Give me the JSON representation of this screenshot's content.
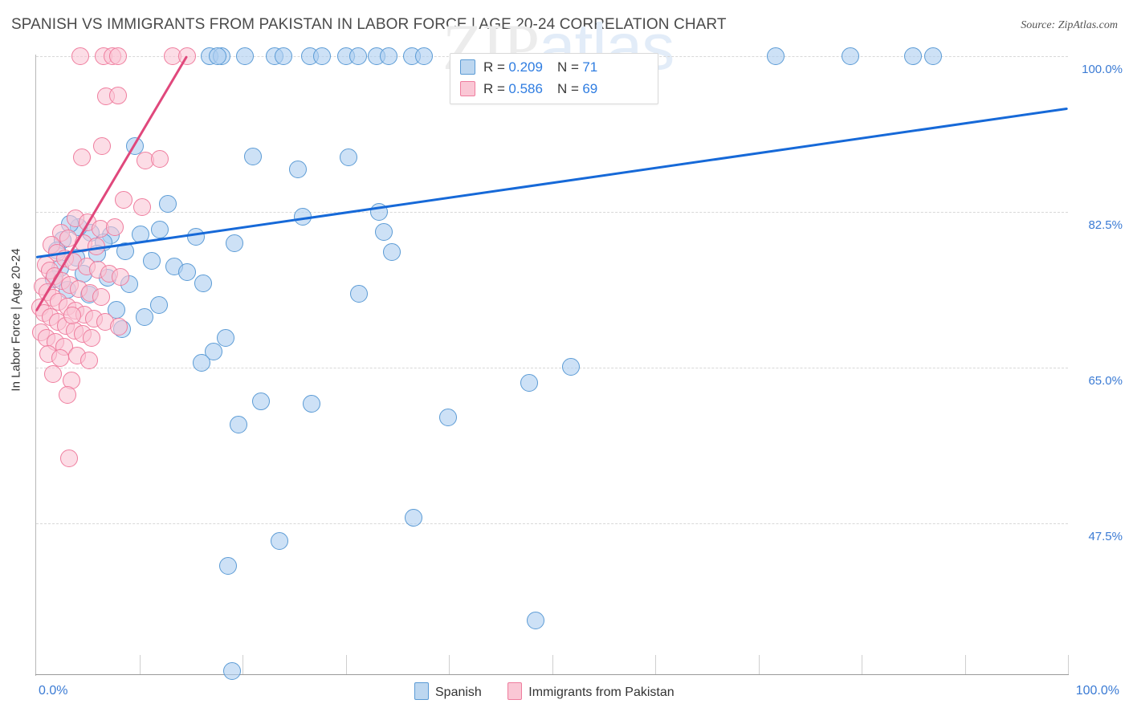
{
  "header": {
    "title": "SPANISH VS IMMIGRANTS FROM PAKISTAN IN LABOR FORCE | AGE 20-24 CORRELATION CHART",
    "source": "Source: ZipAtlas.com"
  },
  "watermark": {
    "part1": "ZIP",
    "part2": "atlas"
  },
  "stats_legend": {
    "rows": [
      {
        "color": "#bdd7f0",
        "r_label": "R =",
        "r_value": "0.209",
        "n_label": "N =",
        "n_value": "71"
      },
      {
        "color": "#fac7d5",
        "r_label": "R =",
        "r_value": "0.586",
        "n_label": "N =",
        "n_value": "69"
      }
    ]
  },
  "bottom_legend": {
    "items": [
      {
        "label": "Spanish",
        "color": "#bdd7f0"
      },
      {
        "label": "Immigrants from Pakistan",
        "color": "#fac7d5"
      }
    ]
  },
  "chart_data": {
    "type": "scatter",
    "title": "SPANISH VS IMMIGRANTS FROM PAKISTAN IN LABOR FORCE | AGE 20-24 CORRELATION CHART",
    "xlabel": "",
    "ylabel": "In Labor Force | Age 20-24",
    "xlim": [
      0,
      100
    ],
    "ylim": [
      30.6,
      100.0
    ],
    "grid": true,
    "legend_position": "bottom-center",
    "x_tick_labels": [
      "0.0%",
      "100.0%"
    ],
    "y_tick_labels": [
      "100.0%",
      "82.5%",
      "65.0%",
      "47.5%"
    ],
    "y_ticks": [
      100.0,
      82.5,
      65.0,
      47.5
    ],
    "series": [
      {
        "name": "Spanish",
        "color": "#bdd7f0",
        "edge_color": "#5b9bd5",
        "r": 0.209,
        "n": 71,
        "trendline": {
          "x0": 0.0,
          "y0": 77.4,
          "x1": 100.0,
          "y1": 94.1
        },
        "points": [
          [
            16.8,
            100.0
          ],
          [
            18.0,
            100.0
          ],
          [
            17.6,
            100.0
          ],
          [
            20.2,
            100.0
          ],
          [
            23.1,
            100.0
          ],
          [
            24.0,
            100.0
          ],
          [
            26.5,
            100.0
          ],
          [
            27.7,
            100.0
          ],
          [
            30.0,
            100.0
          ],
          [
            31.2,
            100.0
          ],
          [
            33.0,
            100.0
          ],
          [
            34.2,
            100.0
          ],
          [
            36.4,
            100.0
          ],
          [
            37.6,
            100.0
          ],
          [
            71.7,
            100.0
          ],
          [
            78.9,
            100.0
          ],
          [
            85.0,
            100.0
          ],
          [
            86.9,
            100.0
          ],
          [
            9.6,
            89.9
          ],
          [
            21.0,
            88.7
          ],
          [
            25.4,
            87.3
          ],
          [
            30.3,
            88.6
          ],
          [
            12.8,
            83.4
          ],
          [
            25.8,
            82.0
          ],
          [
            33.2,
            82.5
          ],
          [
            12.0,
            80.5
          ],
          [
            10.1,
            80.0
          ],
          [
            7.2,
            79.9
          ],
          [
            5.3,
            80.2
          ],
          [
            4.1,
            80.8
          ],
          [
            6.5,
            79.1
          ],
          [
            15.5,
            79.7
          ],
          [
            19.2,
            79.0
          ],
          [
            8.6,
            78.1
          ],
          [
            3.3,
            81.2
          ],
          [
            2.6,
            79.4
          ],
          [
            2.0,
            78.2
          ],
          [
            3.9,
            77.4
          ],
          [
            5.9,
            77.8
          ],
          [
            11.2,
            77.0
          ],
          [
            13.4,
            76.4
          ],
          [
            14.6,
            75.8
          ],
          [
            33.7,
            80.3
          ],
          [
            34.5,
            78.0
          ],
          [
            2.3,
            76.2
          ],
          [
            4.6,
            75.6
          ],
          [
            6.9,
            75.1
          ],
          [
            9.0,
            74.4
          ],
          [
            1.7,
            74.9
          ],
          [
            3.0,
            73.8
          ],
          [
            5.1,
            73.2
          ],
          [
            16.2,
            74.5
          ],
          [
            11.9,
            72.1
          ],
          [
            7.8,
            71.5
          ],
          [
            10.5,
            70.7
          ],
          [
            31.3,
            73.3
          ],
          [
            8.3,
            69.4
          ],
          [
            18.4,
            68.4
          ],
          [
            17.2,
            66.8
          ],
          [
            16.0,
            65.6
          ],
          [
            51.8,
            65.1
          ],
          [
            47.8,
            63.3
          ],
          [
            21.8,
            61.2
          ],
          [
            26.7,
            61.0
          ],
          [
            19.6,
            58.6
          ],
          [
            39.9,
            59.4
          ],
          [
            36.6,
            48.2
          ],
          [
            23.6,
            45.6
          ],
          [
            18.6,
            42.8
          ],
          [
            48.4,
            36.6
          ],
          [
            19.0,
            31.0
          ]
        ]
      },
      {
        "name": "Immigrants from Pakistan",
        "color": "#fac7d5",
        "edge_color": "#ef7d9e",
        "r": 0.586,
        "n": 69,
        "trendline": {
          "x0": 0.0,
          "y0": 71.4,
          "x1": 14.6,
          "y1": 100.0
        },
        "points": [
          [
            4.3,
            100.0
          ],
          [
            6.5,
            100.0
          ],
          [
            7.4,
            100.0
          ],
          [
            7.9,
            100.0
          ],
          [
            13.2,
            100.0
          ],
          [
            14.6,
            100.0
          ],
          [
            6.8,
            95.5
          ],
          [
            7.9,
            95.6
          ],
          [
            6.4,
            89.9
          ],
          [
            4.4,
            88.6
          ],
          [
            10.6,
            88.3
          ],
          [
            12.0,
            88.5
          ],
          [
            8.5,
            83.9
          ],
          [
            10.3,
            83.1
          ],
          [
            3.8,
            81.8
          ],
          [
            5.0,
            81.3
          ],
          [
            6.2,
            80.6
          ],
          [
            7.6,
            80.8
          ],
          [
            2.4,
            80.2
          ],
          [
            3.1,
            79.5
          ],
          [
            4.6,
            79.0
          ],
          [
            5.8,
            78.6
          ],
          [
            1.5,
            78.8
          ],
          [
            2.0,
            77.9
          ],
          [
            2.8,
            77.3
          ],
          [
            3.6,
            76.9
          ],
          [
            4.9,
            76.4
          ],
          [
            6.0,
            76.0
          ],
          [
            7.1,
            75.6
          ],
          [
            8.2,
            75.2
          ],
          [
            0.9,
            76.6
          ],
          [
            1.3,
            75.9
          ],
          [
            1.8,
            75.3
          ],
          [
            2.5,
            74.8
          ],
          [
            3.3,
            74.3
          ],
          [
            4.1,
            73.9
          ],
          [
            5.2,
            73.4
          ],
          [
            6.3,
            73.0
          ],
          [
            0.6,
            74.1
          ],
          [
            1.1,
            73.5
          ],
          [
            1.6,
            72.9
          ],
          [
            2.2,
            72.4
          ],
          [
            3.0,
            71.9
          ],
          [
            3.8,
            71.4
          ],
          [
            4.7,
            71.0
          ],
          [
            5.6,
            70.5
          ],
          [
            0.4,
            71.8
          ],
          [
            0.8,
            71.2
          ],
          [
            1.4,
            70.7
          ],
          [
            2.1,
            70.2
          ],
          [
            2.9,
            69.7
          ],
          [
            3.7,
            69.2
          ],
          [
            4.5,
            68.8
          ],
          [
            5.4,
            68.4
          ],
          [
            0.5,
            69.0
          ],
          [
            1.0,
            68.4
          ],
          [
            1.9,
            67.9
          ],
          [
            2.7,
            67.4
          ],
          [
            3.5,
            70.9
          ],
          [
            6.7,
            70.2
          ],
          [
            8.0,
            69.6
          ],
          [
            1.2,
            66.6
          ],
          [
            2.3,
            66.1
          ],
          [
            4.0,
            66.4
          ],
          [
            5.1,
            65.8
          ],
          [
            1.6,
            64.3
          ],
          [
            3.4,
            63.6
          ],
          [
            3.0,
            62.0
          ],
          [
            3.2,
            54.8
          ]
        ]
      }
    ]
  }
}
